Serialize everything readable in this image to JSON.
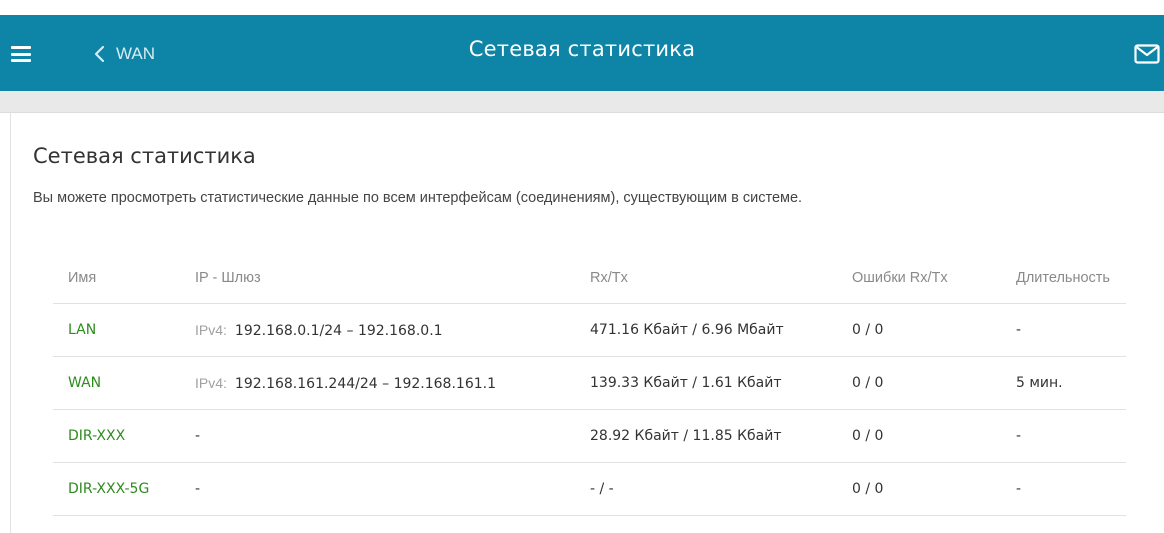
{
  "header": {
    "back_label": "WAN",
    "title": "Сетевая статистика",
    "bg_color": "#0E84A6"
  },
  "icons": {
    "menu": "hamburger-menu-icon",
    "back": "chevron-left-icon",
    "mail": "envelope-icon"
  },
  "main": {
    "title": "Сетевая статистика",
    "description": "Вы можете просмотреть статистические данные по всем интерфейсам (соединениям), существующим в системе."
  },
  "table": {
    "columns": [
      "Имя",
      "IP - Шлюз",
      "Rx/Tx",
      "Ошибки Rx/Tx",
      "Длительность"
    ],
    "rows": [
      {
        "name": "LAN",
        "ip_prefix": "IPv4:",
        "ip": "192.168.0.1/24 – 192.168.0.1",
        "rxtx": "471.16 Кбайт / 6.96 Мбайт",
        "errors": "0 / 0",
        "duration": "-"
      },
      {
        "name": "WAN",
        "ip_prefix": "IPv4:",
        "ip": "192.168.161.244/24 – 192.168.161.1",
        "rxtx": "139.33 Кбайт / 1.61 Кбайт",
        "errors": "0 / 0",
        "duration": "5 мин."
      },
      {
        "name": "DIR-XXX",
        "ip_prefix": "",
        "ip": "-",
        "rxtx": "28.92 Кбайт / 11.85 Кбайт",
        "errors": "0 / 0",
        "duration": "-"
      },
      {
        "name": "DIR-XXX-5G",
        "ip_prefix": "",
        "ip": "-",
        "rxtx": "- / -",
        "errors": "0 / 0",
        "duration": "-"
      }
    ]
  },
  "colors": {
    "link_green": "#2E8B1E",
    "header_text": "#ffffff"
  }
}
